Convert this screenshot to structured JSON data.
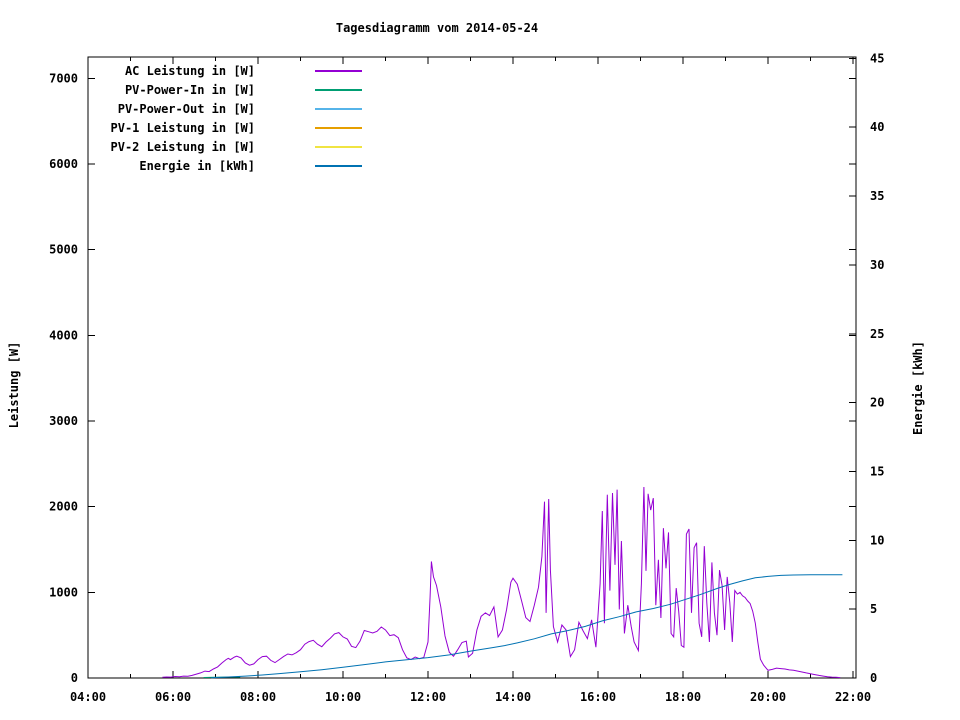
{
  "chart_data": {
    "type": "line",
    "title": "Tagesdiagramm vom 2014-05-24",
    "ylabel": "Leistung [W]",
    "y2label": "Energie [kWh]",
    "grid": false,
    "legend_position": "top-left-inside",
    "x_axis": {
      "unit": "time",
      "start_hour": 4,
      "end_hour": 22,
      "major_step_hours": 2,
      "minor_step_hours": 1,
      "tick_labels": [
        "04:00",
        "06:00",
        "08:00",
        "10:00",
        "12:00",
        "14:00",
        "16:00",
        "18:00",
        "20:00",
        "22:00"
      ]
    },
    "y_axis": {
      "label": "Leistung [W]",
      "min": 0,
      "max": 7000,
      "step": 1000,
      "range_max": 7250,
      "tick_labels": [
        "0",
        "1000",
        "2000",
        "3000",
        "4000",
        "5000",
        "6000",
        "7000"
      ]
    },
    "y2_axis": {
      "label": "Energie [kWh]",
      "min": 0,
      "max": 45,
      "step": 5,
      "range_max": 45.1,
      "tick_labels": [
        "0",
        "5",
        "10",
        "15",
        "20",
        "25",
        "30",
        "35",
        "40",
        "45"
      ]
    },
    "series": [
      {
        "name": "AC Leistung in [W]",
        "color": "#9400D3",
        "axis": "y",
        "note": "spiky PV AC output curve, ~05:45 to ~21:42, peaks ~2100-2230 W between 14:40 and 17:30",
        "points": [
          [
            5.75,
            8
          ],
          [
            5.85,
            12
          ],
          [
            5.95,
            10
          ],
          [
            6.05,
            18
          ],
          [
            6.15,
            15
          ],
          [
            6.25,
            22
          ],
          [
            6.35,
            20
          ],
          [
            6.45,
            30
          ],
          [
            6.55,
            45
          ],
          [
            6.65,
            60
          ],
          [
            6.75,
            80
          ],
          [
            6.85,
            75
          ],
          [
            6.95,
            105
          ],
          [
            7.05,
            130
          ],
          [
            7.15,
            175
          ],
          [
            7.25,
            215
          ],
          [
            7.3,
            230
          ],
          [
            7.35,
            215
          ],
          [
            7.45,
            245
          ],
          [
            7.5,
            255
          ],
          [
            7.6,
            235
          ],
          [
            7.7,
            175
          ],
          [
            7.8,
            150
          ],
          [
            7.9,
            165
          ],
          [
            8.0,
            215
          ],
          [
            8.1,
            250
          ],
          [
            8.2,
            255
          ],
          [
            8.3,
            205
          ],
          [
            8.4,
            180
          ],
          [
            8.5,
            215
          ],
          [
            8.6,
            250
          ],
          [
            8.7,
            280
          ],
          [
            8.8,
            270
          ],
          [
            8.9,
            295
          ],
          [
            9.0,
            330
          ],
          [
            9.1,
            395
          ],
          [
            9.2,
            425
          ],
          [
            9.3,
            440
          ],
          [
            9.4,
            395
          ],
          [
            9.5,
            365
          ],
          [
            9.6,
            420
          ],
          [
            9.7,
            465
          ],
          [
            9.8,
            515
          ],
          [
            9.9,
            530
          ],
          [
            10.0,
            480
          ],
          [
            10.1,
            455
          ],
          [
            10.2,
            370
          ],
          [
            10.3,
            355
          ],
          [
            10.4,
            430
          ],
          [
            10.5,
            555
          ],
          [
            10.6,
            540
          ],
          [
            10.7,
            525
          ],
          [
            10.8,
            545
          ],
          [
            10.9,
            595
          ],
          [
            11.0,
            560
          ],
          [
            11.1,
            495
          ],
          [
            11.2,
            505
          ],
          [
            11.3,
            470
          ],
          [
            11.4,
            330
          ],
          [
            11.5,
            235
          ],
          [
            11.6,
            215
          ],
          [
            11.7,
            245
          ],
          [
            11.8,
            225
          ],
          [
            11.9,
            240
          ],
          [
            12.0,
            420
          ],
          [
            12.05,
            950
          ],
          [
            12.08,
            1360
          ],
          [
            12.13,
            1180
          ],
          [
            12.2,
            1080
          ],
          [
            12.3,
            830
          ],
          [
            12.4,
            490
          ],
          [
            12.5,
            300
          ],
          [
            12.6,
            255
          ],
          [
            12.7,
            330
          ],
          [
            12.8,
            415
          ],
          [
            12.9,
            430
          ],
          [
            12.95,
            245
          ],
          [
            13.05,
            290
          ],
          [
            13.15,
            560
          ],
          [
            13.25,
            720
          ],
          [
            13.35,
            760
          ],
          [
            13.45,
            730
          ],
          [
            13.55,
            830
          ],
          [
            13.65,
            480
          ],
          [
            13.75,
            560
          ],
          [
            13.85,
            800
          ],
          [
            13.95,
            1120
          ],
          [
            14.0,
            1165
          ],
          [
            14.1,
            1095
          ],
          [
            14.2,
            905
          ],
          [
            14.3,
            705
          ],
          [
            14.4,
            660
          ],
          [
            14.5,
            850
          ],
          [
            14.6,
            1060
          ],
          [
            14.68,
            1420
          ],
          [
            14.74,
            2060
          ],
          [
            14.78,
            760
          ],
          [
            14.84,
            2090
          ],
          [
            14.88,
            1260
          ],
          [
            14.95,
            600
          ],
          [
            15.05,
            420
          ],
          [
            15.15,
            620
          ],
          [
            15.25,
            560
          ],
          [
            15.35,
            250
          ],
          [
            15.45,
            330
          ],
          [
            15.55,
            650
          ],
          [
            15.65,
            550
          ],
          [
            15.75,
            460
          ],
          [
            15.85,
            680
          ],
          [
            15.95,
            360
          ],
          [
            16.05,
            1100
          ],
          [
            16.1,
            1950
          ],
          [
            16.15,
            640
          ],
          [
            16.22,
            2140
          ],
          [
            16.28,
            1020
          ],
          [
            16.34,
            2160
          ],
          [
            16.4,
            1320
          ],
          [
            16.45,
            2200
          ],
          [
            16.5,
            800
          ],
          [
            16.55,
            1600
          ],
          [
            16.62,
            520
          ],
          [
            16.7,
            850
          ],
          [
            16.78,
            600
          ],
          [
            16.85,
            420
          ],
          [
            16.95,
            320
          ],
          [
            17.02,
            1100
          ],
          [
            17.08,
            2230
          ],
          [
            17.13,
            1250
          ],
          [
            17.18,
            2150
          ],
          [
            17.24,
            1960
          ],
          [
            17.3,
            2100
          ],
          [
            17.36,
            850
          ],
          [
            17.42,
            1380
          ],
          [
            17.48,
            700
          ],
          [
            17.54,
            1750
          ],
          [
            17.6,
            1280
          ],
          [
            17.66,
            1700
          ],
          [
            17.72,
            520
          ],
          [
            17.78,
            480
          ],
          [
            17.84,
            1050
          ],
          [
            17.9,
            780
          ],
          [
            17.96,
            380
          ],
          [
            18.02,
            360
          ],
          [
            18.08,
            1680
          ],
          [
            18.14,
            1740
          ],
          [
            18.2,
            760
          ],
          [
            18.26,
            1520
          ],
          [
            18.32,
            1580
          ],
          [
            18.38,
            640
          ],
          [
            18.44,
            480
          ],
          [
            18.5,
            1540
          ],
          [
            18.56,
            880
          ],
          [
            18.62,
            420
          ],
          [
            18.68,
            1350
          ],
          [
            18.74,
            760
          ],
          [
            18.8,
            500
          ],
          [
            18.86,
            1260
          ],
          [
            18.92,
            1080
          ],
          [
            18.98,
            560
          ],
          [
            19.04,
            1180
          ],
          [
            19.1,
            880
          ],
          [
            19.16,
            420
          ],
          [
            19.22,
            1020
          ],
          [
            19.28,
            980
          ],
          [
            19.34,
            1000
          ],
          [
            19.4,
            960
          ],
          [
            19.46,
            940
          ],
          [
            19.52,
            900
          ],
          [
            19.58,
            870
          ],
          [
            19.64,
            780
          ],
          [
            19.7,
            640
          ],
          [
            19.76,
            420
          ],
          [
            19.82,
            220
          ],
          [
            19.9,
            150
          ],
          [
            20.0,
            90
          ],
          [
            20.1,
            100
          ],
          [
            20.2,
            115
          ],
          [
            20.3,
            110
          ],
          [
            20.4,
            105
          ],
          [
            20.5,
            95
          ],
          [
            20.6,
            90
          ],
          [
            20.7,
            80
          ],
          [
            20.8,
            70
          ],
          [
            20.9,
            60
          ],
          [
            21.0,
            50
          ],
          [
            21.1,
            40
          ],
          [
            21.2,
            30
          ],
          [
            21.3,
            22
          ],
          [
            21.4,
            15
          ],
          [
            21.5,
            10
          ],
          [
            21.6,
            8
          ],
          [
            21.7,
            5
          ]
        ]
      },
      {
        "name": "PV-Power-In in [W]",
        "color": "#009E73",
        "axis": "y",
        "note": "only a short near-zero segment visible ~06:45-07:35; elsewhere hidden behind AC curve",
        "points": [
          [
            6.72,
            6
          ],
          [
            7.0,
            8
          ],
          [
            7.3,
            10
          ],
          [
            7.58,
            12
          ]
        ]
      },
      {
        "name": "PV-Power-Out in [W]",
        "color": "#56B4E9",
        "axis": "y",
        "note": "not visible in plot area (hidden behind other curves)",
        "points": []
      },
      {
        "name": "PV-1 Leistung in [W]",
        "color": "#E69F00",
        "axis": "y",
        "note": "not visible in plot area (hidden behind other curves)",
        "points": []
      },
      {
        "name": "PV-2 Leistung in [W]",
        "color": "#F0E442",
        "axis": "y",
        "note": "not visible in plot area (hidden behind other curves)",
        "points": []
      },
      {
        "name": "Energie in [kWh]",
        "color": "#0072B2",
        "axis": "y2",
        "note": "cumulative daily energy, rises from ~07:00 and flattens at ~7.5 kWh after ~20:30",
        "points": [
          [
            6.9,
            0.02
          ],
          [
            7.3,
            0.07
          ],
          [
            7.7,
            0.14
          ],
          [
            8.1,
            0.22
          ],
          [
            8.5,
            0.32
          ],
          [
            9.0,
            0.45
          ],
          [
            9.5,
            0.6
          ],
          [
            10.0,
            0.78
          ],
          [
            10.5,
            0.97
          ],
          [
            11.0,
            1.17
          ],
          [
            11.5,
            1.33
          ],
          [
            12.0,
            1.48
          ],
          [
            12.5,
            1.68
          ],
          [
            13.0,
            1.95
          ],
          [
            13.5,
            2.2
          ],
          [
            13.8,
            2.35
          ],
          [
            14.1,
            2.55
          ],
          [
            14.5,
            2.85
          ],
          [
            14.9,
            3.2
          ],
          [
            15.3,
            3.45
          ],
          [
            15.7,
            3.75
          ],
          [
            16.1,
            4.15
          ],
          [
            16.5,
            4.45
          ],
          [
            16.9,
            4.8
          ],
          [
            17.3,
            5.05
          ],
          [
            17.7,
            5.35
          ],
          [
            18.0,
            5.65
          ],
          [
            18.4,
            6.05
          ],
          [
            18.8,
            6.5
          ],
          [
            19.1,
            6.8
          ],
          [
            19.4,
            7.05
          ],
          [
            19.7,
            7.28
          ],
          [
            20.0,
            7.38
          ],
          [
            20.3,
            7.45
          ],
          [
            20.6,
            7.48
          ],
          [
            21.0,
            7.5
          ],
          [
            21.45,
            7.5
          ],
          [
            21.75,
            7.5
          ]
        ]
      }
    ]
  }
}
